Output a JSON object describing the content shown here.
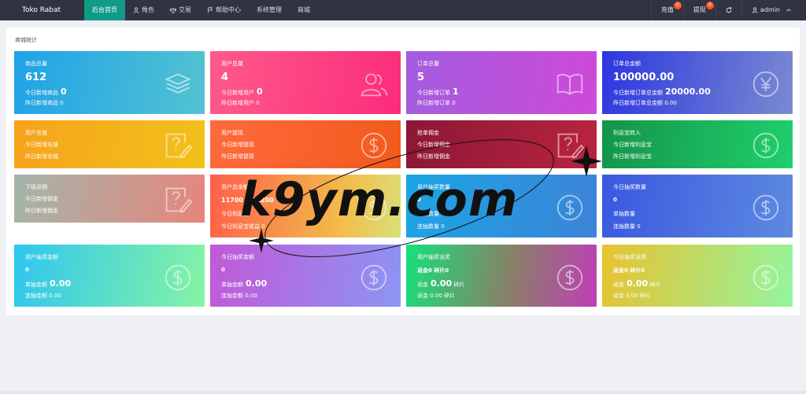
{
  "app": {
    "brand": "Toko Rabat"
  },
  "nav": [
    {
      "label": "后台首页",
      "icon": ""
    },
    {
      "label": "角色",
      "icon": "user-icon"
    },
    {
      "label": "交易",
      "icon": "scale-icon"
    },
    {
      "label": "帮助中心",
      "icon": "flag-icon"
    },
    {
      "label": "系统管理",
      "icon": ""
    },
    {
      "label": "商城",
      "icon": ""
    }
  ],
  "right_nav": {
    "recharge": {
      "label": "充值",
      "badge": "0"
    },
    "withdraw": {
      "label": "提现",
      "badge": "0"
    },
    "refresh_icon": "refresh-icon",
    "user": {
      "label": "admin",
      "icon": "user-icon",
      "caret": "chevron-down-icon"
    }
  },
  "panel": {
    "title": "商城统计"
  },
  "cards": [
    {
      "title": "商品总量",
      "big": "612",
      "line1_label": "今日新增商品",
      "line1_value": "0",
      "line2": "昨日新增商品 0",
      "icon": "stack-icon"
    },
    {
      "title": "用户总量",
      "big": "4",
      "line1_label": "今日新增用户",
      "line1_value": "0",
      "line2": "昨日新增用户 0",
      "icon": "users-icon"
    },
    {
      "title": "订单总量",
      "big": "5",
      "line1_label": "今日新增订单",
      "line1_value": "1",
      "line2": "昨日新增订单 0",
      "icon": "book-icon"
    },
    {
      "title": "订单总金额",
      "big": "100000.00",
      "line1_label": "今日新增订单总金额",
      "line1_value": "20000.00",
      "line2": "昨日新增订单总金额 0.00",
      "icon": "yen-icon"
    },
    {
      "title": "用户充值",
      "line1": "今日新增充值",
      "line2": "昨日新增充值",
      "icon": "help-edit-icon"
    },
    {
      "title": "用户提现",
      "line1": "今日新增提现",
      "line2": "昨日新增提现",
      "icon": "dollar-icon"
    },
    {
      "title": "抢单佣金",
      "line1": "今日新增佣金",
      "line2": "昨日新增佣金",
      "icon": "help-edit-icon"
    },
    {
      "title": "利息宝转入",
      "line1": "今日新增利息宝",
      "line2": "昨日新增利息宝",
      "icon": "dollar-icon"
    },
    {
      "title": "下级返佣",
      "line1": "今日新增佣金",
      "line2": "昨日新增佣金",
      "icon": "help-edit-icon"
    },
    {
      "title": "用户总余额",
      "big": "11700",
      "big2": "11200",
      "line1": "今日利息宝",
      "line2": "今日利息宝收益 0",
      "icon": "dollar-icon"
    },
    {
      "title": "用户抽奖数量",
      "big": "0",
      "line1": "单抽数量",
      "line2": "连抽数量 0",
      "icon": "dollar-icon"
    },
    {
      "title": "今日抽奖数量",
      "big": "0",
      "line1": "单抽数量",
      "line2": "连抽数量 0",
      "icon": "dollar-icon"
    },
    {
      "title": "用户抽奖金额",
      "big": "0",
      "line1_label": "单抽金额",
      "line1_value": "0.00",
      "line2": "连抽金额 0.00",
      "icon": "dollar-icon"
    },
    {
      "title": "今日抽奖金额",
      "big": "0",
      "line1_label": "单抽金额",
      "line1_value": "0.00",
      "line2": "连抽金额 0.00",
      "icon": "dollar-icon"
    },
    {
      "title": "用户抽奖派奖",
      "l0": "returnfix",
      "big_line": "返金0 碎片0",
      "line1_label": "返金",
      "line1_value": "0.00",
      "line1_suffix": "碎片",
      "line2": "返金 0.00 碎片",
      "icon": "dollar-icon"
    },
    {
      "title": "今日抽奖派奖",
      "big_line": "返金0 碎片0",
      "line1_label": "返金",
      "line1_value": "0.00",
      "line1_suffix": "碎片",
      "line2": "返金 0.00 碎片",
      "icon": "dollar-icon"
    }
  ],
  "watermark": "k9ym.com"
}
